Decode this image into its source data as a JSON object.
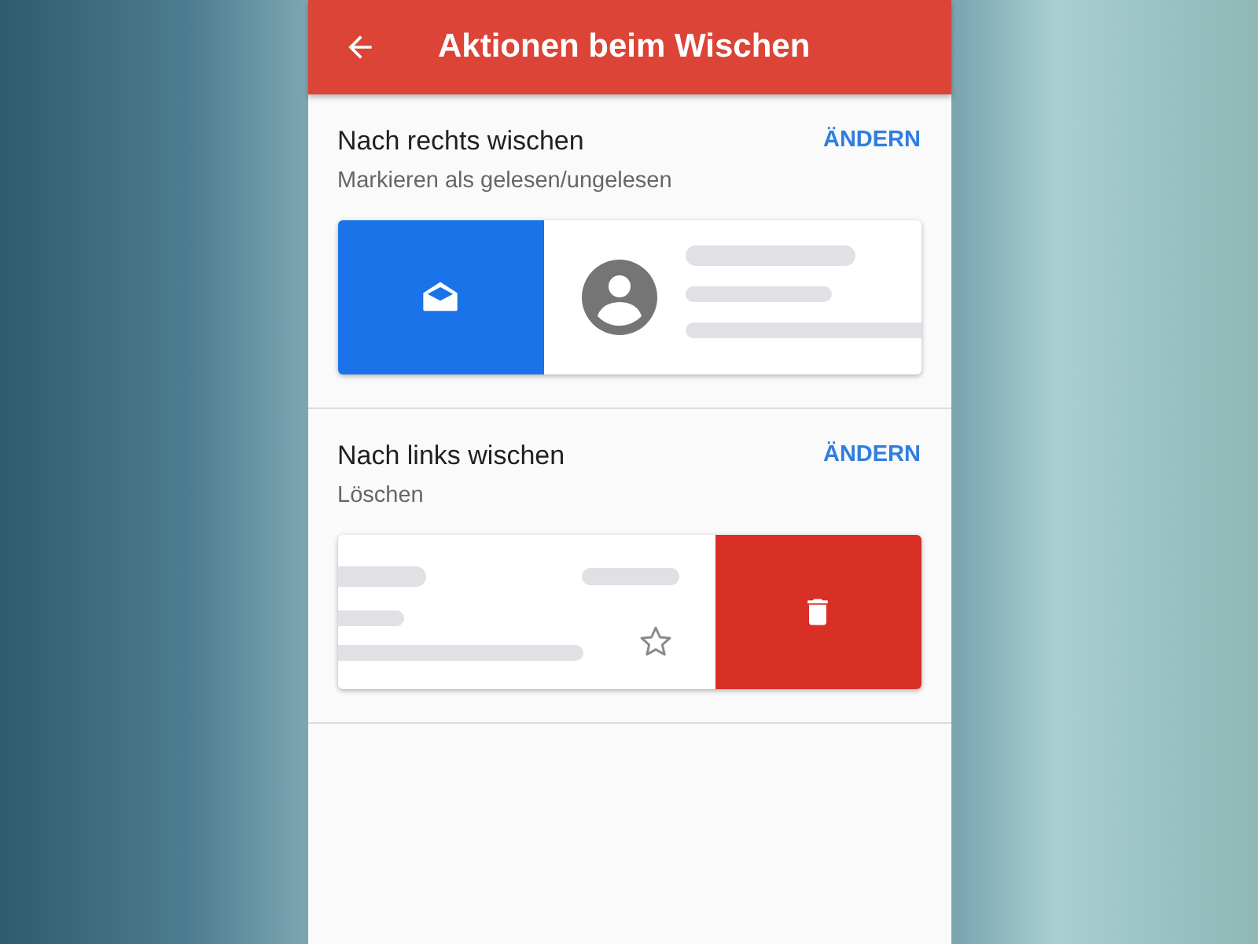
{
  "app_bar": {
    "title": "Aktionen beim Wischen"
  },
  "sections": [
    {
      "title": "Nach rechts wischen",
      "subtitle": "Markieren als gelesen/ungelesen",
      "action": "ÄNDERN",
      "kind": "right"
    },
    {
      "title": "Nach links wischen",
      "subtitle": "Löschen",
      "action": "ÄNDERN",
      "kind": "left"
    }
  ]
}
